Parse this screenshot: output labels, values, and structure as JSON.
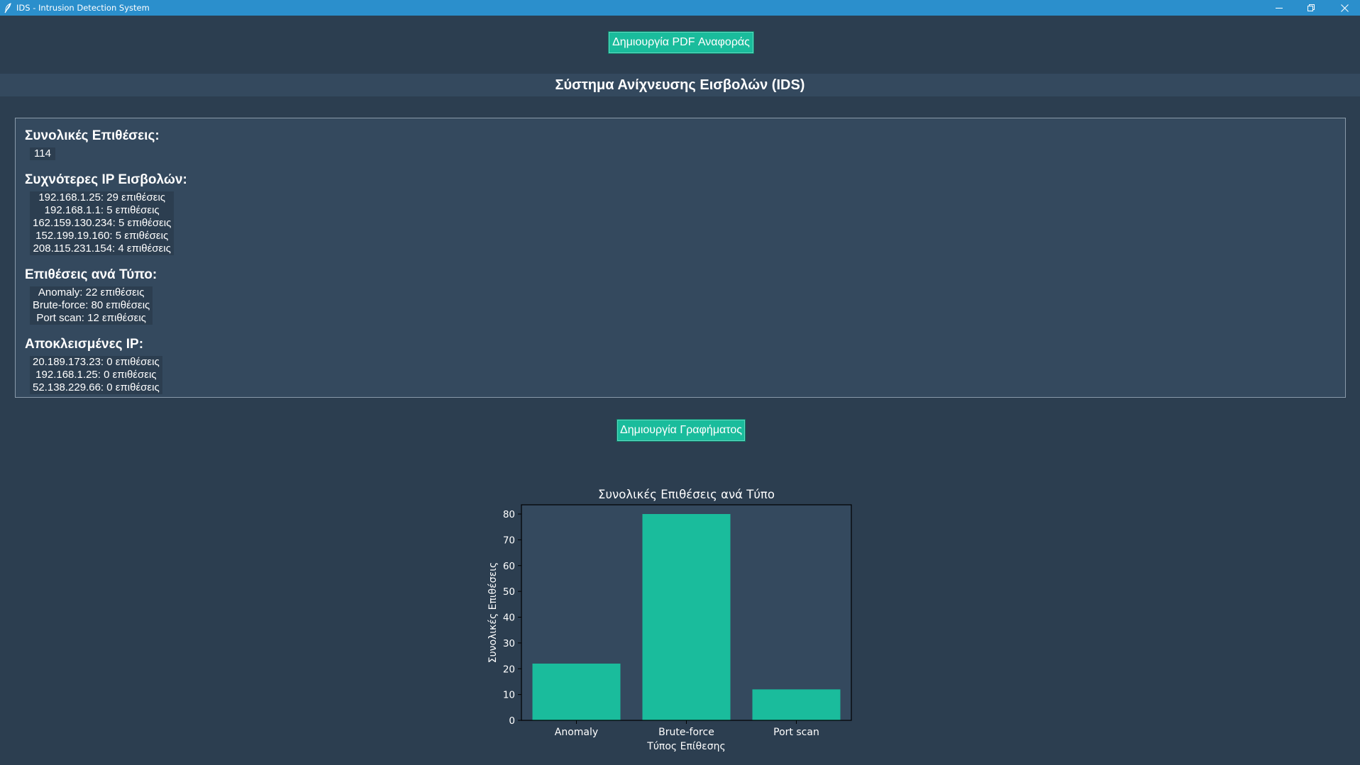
{
  "window": {
    "title": "IDS - Intrusion Detection System",
    "controls": [
      "minimize-icon",
      "restore-icon",
      "close-icon"
    ],
    "titlebar_color": "#2b8fcc"
  },
  "toolbar": {
    "pdf_button": "Δημιουργία PDF Αναφοράς"
  },
  "header": {
    "title": "Σύστημα Ανίχνευσης Εισβολών (IDS)"
  },
  "stats": {
    "total_title": "Συνολικές Επιθέσεις:",
    "total_value": "114",
    "top_ips_title": "Συχνότερες IP Εισβολών:",
    "top_ips": [
      "192.168.1.25: 29 επιθέσεις",
      "192.168.1.1: 5 επιθέσεις",
      "162.159.130.234: 5 επιθέσεις",
      "152.199.19.160: 5 επιθέσεις",
      "208.115.231.154: 4 επιθέσεις"
    ],
    "by_type_title": "Επιθέσεις ανά Τύπο:",
    "by_type": [
      "Anomaly: 22 επιθέσεις",
      "Brute-force: 80 επιθέσεις",
      "Port scan: 12 επιθέσεις"
    ],
    "blocked_title": "Αποκλεισμένες IP:",
    "blocked": [
      "20.189.173.23: 0 επιθέσεις",
      "192.168.1.25: 0 επιθέσεις",
      "52.138.229.66: 0 επιθέσεις"
    ]
  },
  "graph_button": "Δημιουργία Γραφήματος",
  "colors": {
    "background": "#2c3e50",
    "panel": "#34495e",
    "accent": "#1abc9c",
    "text": "#ffffff"
  },
  "chart_data": {
    "type": "bar",
    "title": "Συνολικές Επιθέσεις ανά Τύπο",
    "xlabel": "Τύπος Επίθεσης",
    "ylabel": "Συνολικές Επιθέσεις",
    "categories": [
      "Anomaly",
      "Brute-force",
      "Port scan"
    ],
    "values": [
      22,
      80,
      12
    ],
    "ylim": [
      0,
      80
    ],
    "yticks": [
      0,
      10,
      20,
      30,
      40,
      50,
      60,
      70,
      80
    ],
    "grid": false,
    "bar_color": "#1abc9c"
  }
}
